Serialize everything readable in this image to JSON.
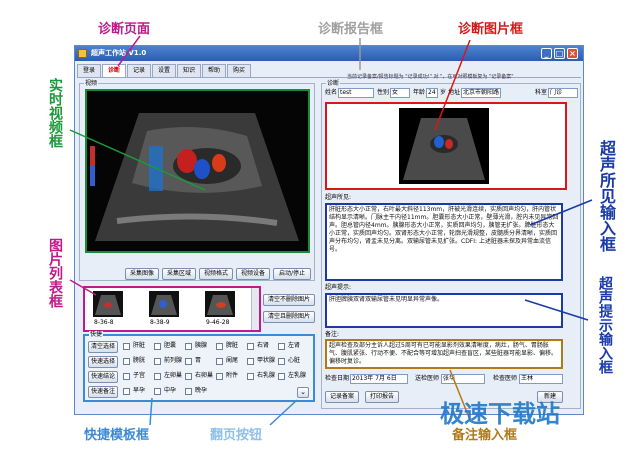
{
  "annotations": {
    "diagnosis_page": "诊断页面",
    "report_frame": "诊断报告框",
    "image_frame": "诊断图片框",
    "live_video_frame": "实时视频框",
    "image_list_frame": "图片列表框",
    "ultrasound_findings_input": "超声所见输入框",
    "ultrasound_hints_input": "超声提示输入框",
    "quick_template_frame": "快捷模板框",
    "page_button": "翻页按钮",
    "remarks_input": "备注输入框"
  },
  "watermark": "极速下载站",
  "window": {
    "title": "超声工作站 V1.0"
  },
  "tabs": [
    "登录",
    "诊断",
    "记录",
    "设置",
    "知识",
    "帮助",
    "购买"
  ],
  "video": {
    "title": "视频",
    "buttons": [
      "采集图像",
      "采集区域",
      "视频格式",
      "视频设备",
      "启动/停止"
    ]
  },
  "thumbnails": [
    "8-36-8",
    "8-38-9",
    "9-46-28"
  ],
  "image_actions": {
    "clear_keep": "清空不删除图片",
    "clear_delete": "清空且删除图片"
  },
  "quick": {
    "title": "快捷",
    "buttons": [
      "清空选择",
      "快速选择",
      "快速结论",
      "快速备注"
    ],
    "grid": [
      [
        "肝脏",
        "胆囊",
        "胰腺",
        "脾脏",
        "右肾",
        "左肾"
      ],
      [
        "膀胱",
        "前列腺",
        "胃",
        "阑尾",
        "甲状腺",
        "心脏"
      ],
      [
        "子宫",
        "左卵巢",
        "右卵巢",
        "附件",
        "右乳腺",
        "左乳腺"
      ],
      [
        "早孕",
        "中孕",
        "晚孕",
        "",
        "",
        ""
      ]
    ]
  },
  "report": {
    "title": "诊断",
    "hint": "当前记录备案/报告标题为 \"记录成功!\" 对 \"，在可对照模板复为 \"记录备案\"",
    "name_label": "姓名",
    "name_value": "test",
    "gender_label": "性别",
    "gender_value": "女",
    "age_label": "年龄",
    "age_value": "24",
    "age_unit": "岁",
    "address_label": "地址",
    "address_value": "北京市朝阳路",
    "dept_label": "科室",
    "dept_value": "门诊",
    "findings_label": "超声所见:",
    "findings_text": "肝脏形态大小正常，右叶最大斜径113mm，肝被光滑连续，实质回声均匀，肝内管状结构显示清晰。门脉主干内径11mm。胆囊形态大小正常，壁薄光滑，腔内未见异常回声。胆总管内径4mm。胰腺形态大小正常，实质回声均匀，胰管无扩张。脾脏形态大小正常，实质回声均匀。双肾形态大小正常，轮廓光滑规整，皮髓质分界清晰，实质回声分布均匀，肾盂未见分离。双输尿管未见扩张。CDFI: 上述脏器未探及异常血流信号。",
    "hints_label": "超声提示:",
    "hints_text": "肝胆脾胰双肾双输尿管未见明显异常声像。",
    "remark_label": "备注:",
    "remark_text": "超声检查及部分主诉人超过5周可有已可能显影剂效果清晰度，病灶，肠气、胃肠胀气、腹肌紧张、行动不便、不配合等可增加超声扫查盲区，某些脏器可能显影、偏移。偏移时复诊。",
    "date_label": "检查日期",
    "date_value": "2013年 7月 6日",
    "sender_label": "送检医师",
    "sender_value": "张华",
    "examiner_label": "检查医师",
    "examiner_value": "王林",
    "btn_save": "记录备案",
    "btn_print": "打印报告",
    "btn_new": "新建"
  }
}
